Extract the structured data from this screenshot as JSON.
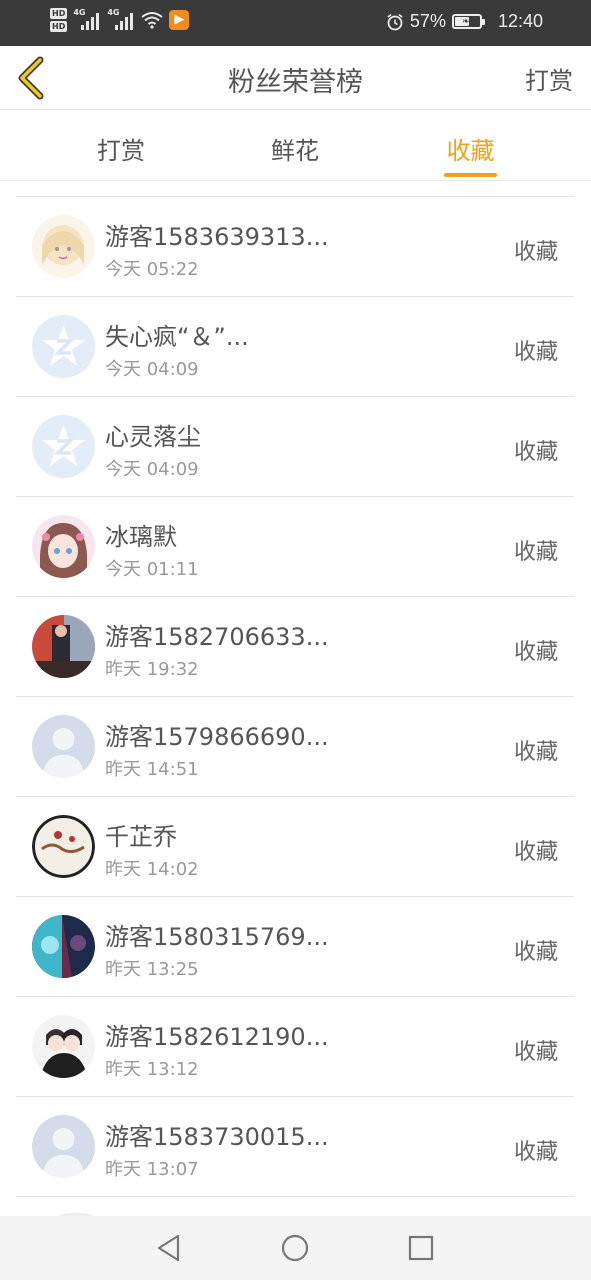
{
  "status_bar": {
    "network_1": "HD",
    "network_2": "HD",
    "signal_1_label": "4G",
    "signal_2_label": "4G",
    "app_icon": "video-app-icon",
    "battery_percent": "57%",
    "battery_level": 0.57,
    "time": "12:40"
  },
  "header": {
    "back_icon": "chevron-left-icon",
    "title": "粉丝荣誉榜",
    "action_label": "打赏",
    "accent_color": "#f0a21a"
  },
  "tabs": [
    {
      "label": "打赏",
      "active": false
    },
    {
      "label": "鲜花",
      "active": false
    },
    {
      "label": "收藏",
      "active": true
    }
  ],
  "fans": [
    {
      "name": "游客1583639313...",
      "time": "今天 05:22",
      "action": "收藏",
      "avatar": "anime-girl-light-avatar"
    },
    {
      "name": "失心疯“＆”...",
      "time": "今天 04:09",
      "action": "收藏",
      "avatar": "qq-default-avatar"
    },
    {
      "name": "心灵落尘",
      "time": "今天 04:09",
      "action": "收藏",
      "avatar": "qq-default-avatar"
    },
    {
      "name": "冰璃默",
      "time": "今天 01:11",
      "action": "收藏",
      "avatar": "anime-girl-pink-avatar"
    },
    {
      "name": "游客1582706633...",
      "time": "昨天 19:32",
      "action": "收藏",
      "avatar": "photo-avatar"
    },
    {
      "name": "游客1579866690...",
      "time": "昨天 14:51",
      "action": "收藏",
      "avatar": "default-person-avatar"
    },
    {
      "name": "千芷乔",
      "time": "昨天 14:02",
      "action": "收藏",
      "avatar": "art-avatar"
    },
    {
      "name": "游客1580315769...",
      "time": "昨天 13:25",
      "action": "收藏",
      "avatar": "blue-art-avatar"
    },
    {
      "name": "游客1582612190...",
      "time": "昨天 13:12",
      "action": "收藏",
      "avatar": "couple-avatar"
    },
    {
      "name": "游客1583730015...",
      "time": "昨天 13:07",
      "action": "收藏",
      "avatar": "default-person-avatar"
    }
  ],
  "nav": {
    "back": "triangle-back-icon",
    "home": "circle-home-icon",
    "recents": "square-recents-icon"
  }
}
